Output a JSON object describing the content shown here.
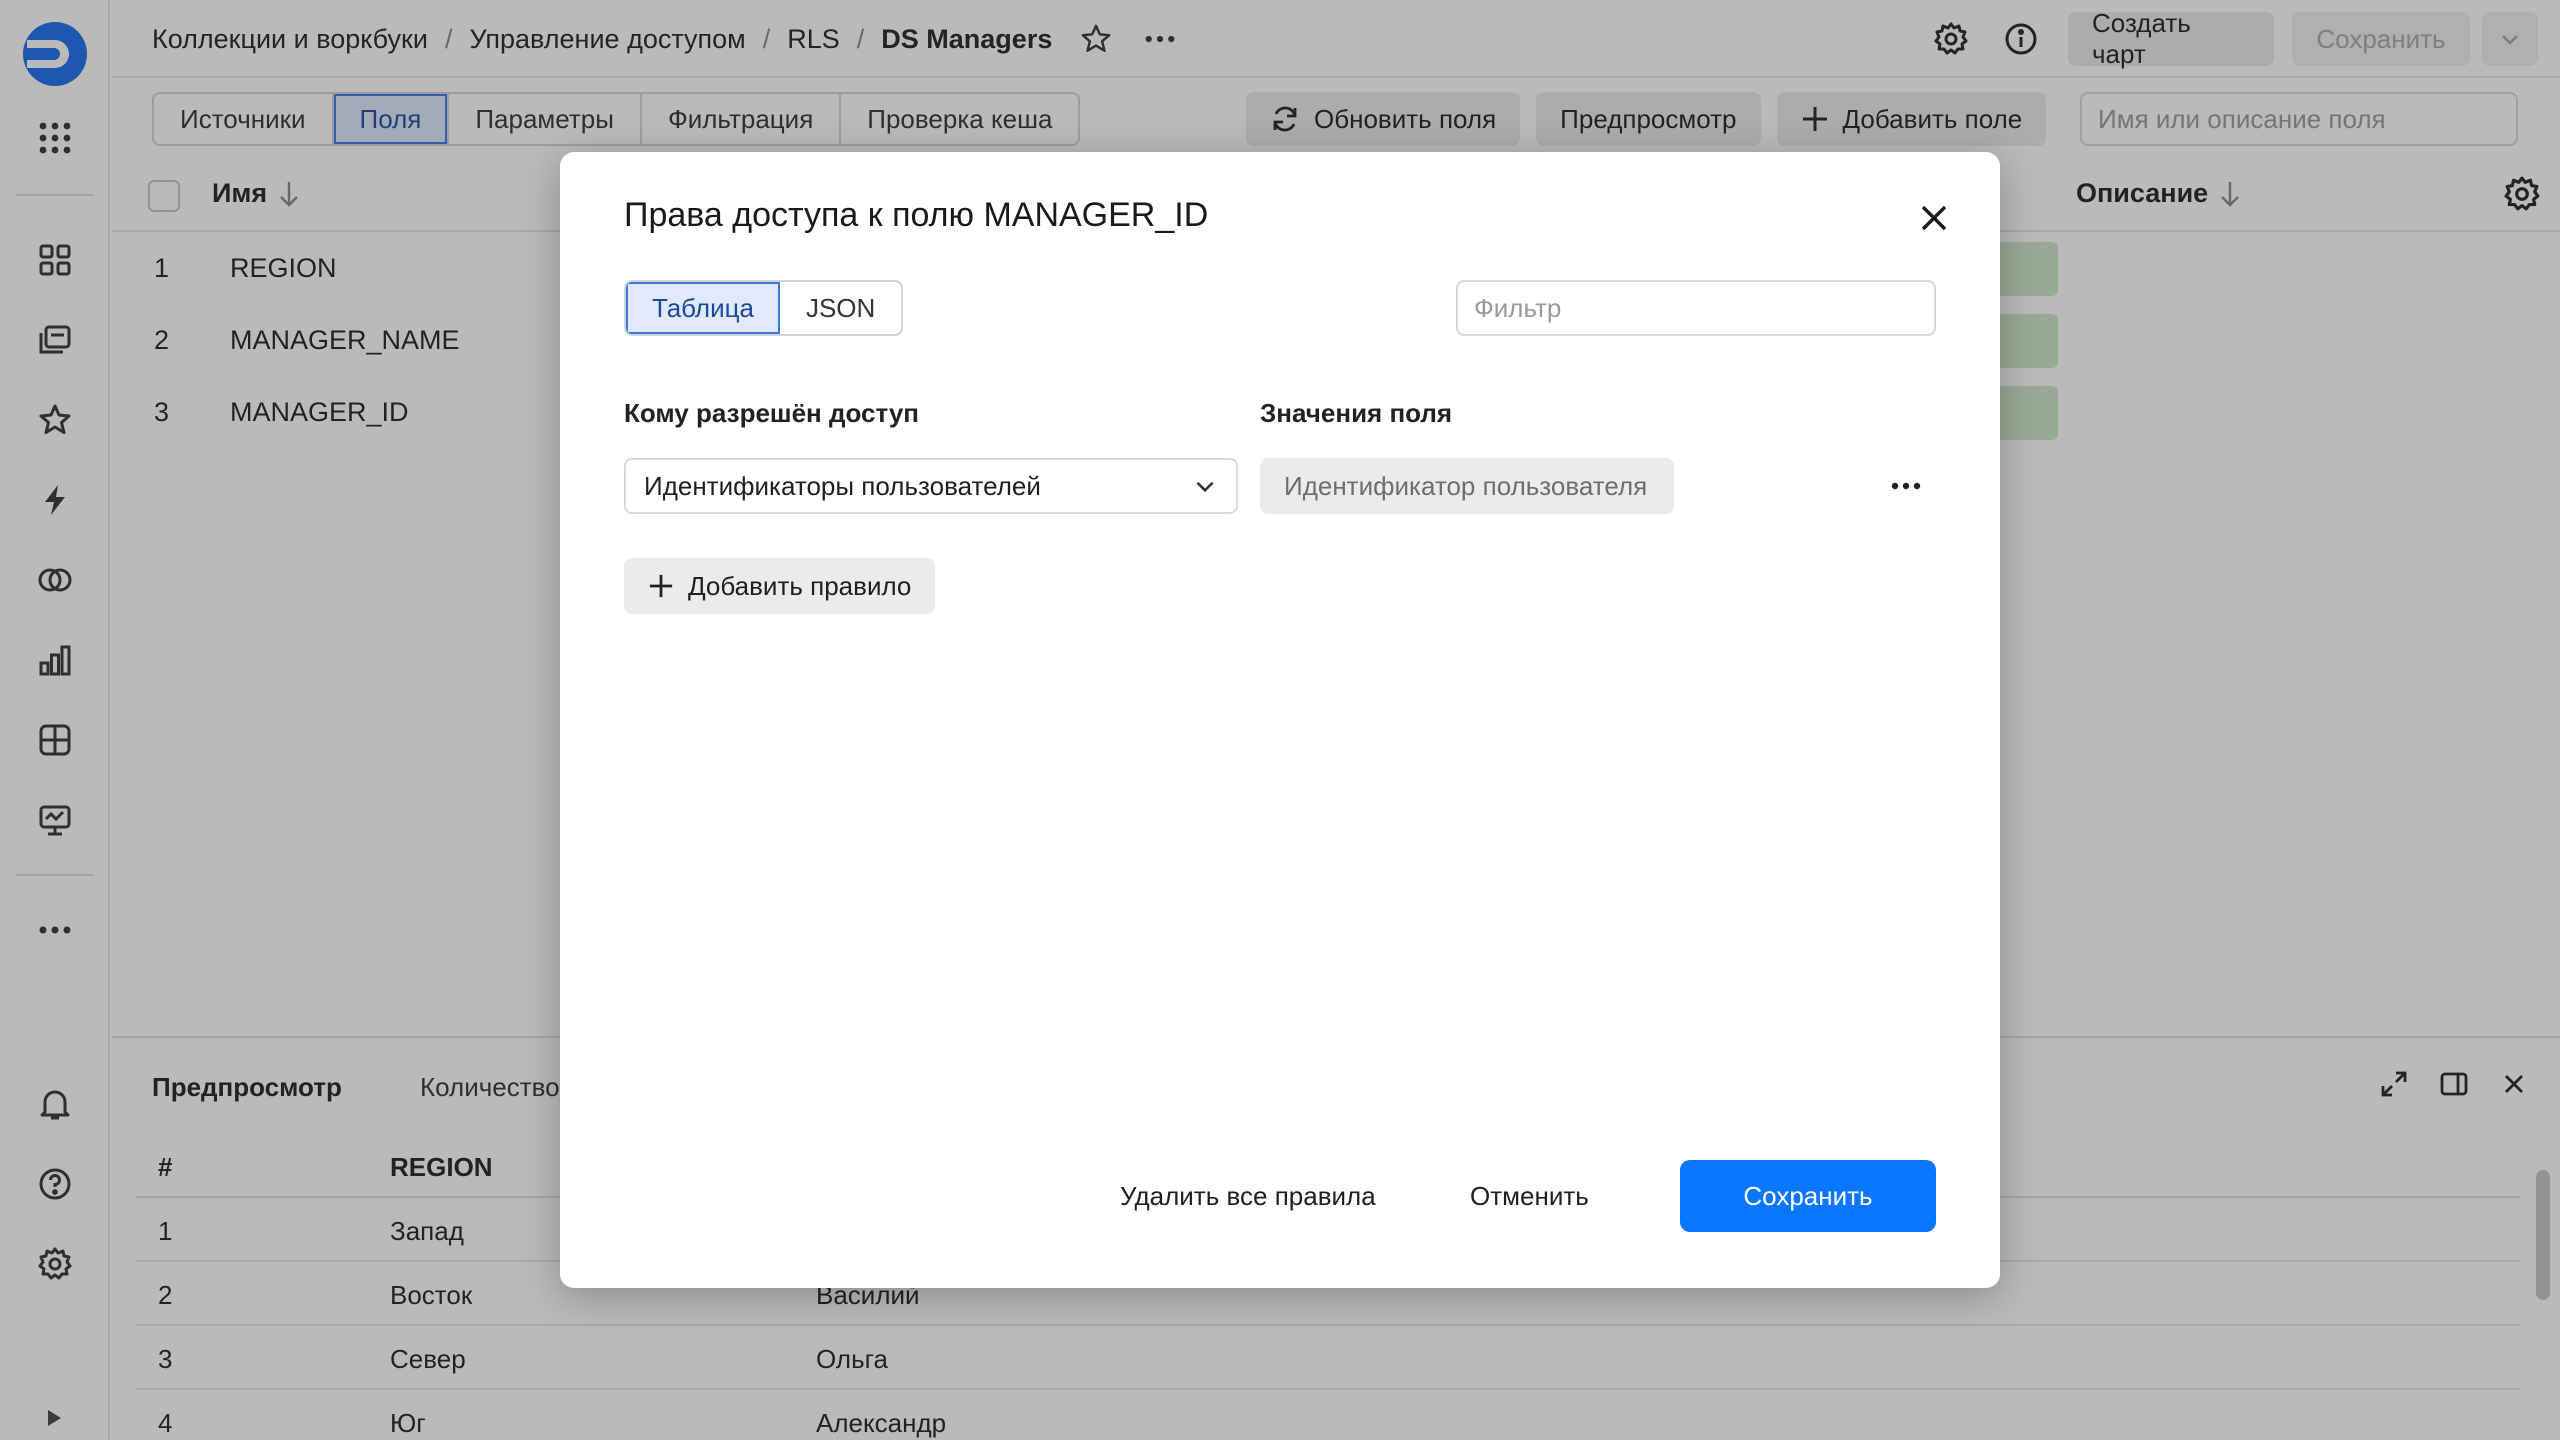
{
  "header": {
    "breadcrumbs": [
      "Коллекции и воркбуки",
      "Управление доступом",
      "RLS"
    ],
    "current": "DS Managers",
    "create_chart_label": "Создать чарт",
    "save_label": "Сохранить"
  },
  "toolbar": {
    "tabs": [
      "Источники",
      "Поля",
      "Параметры",
      "Фильтрация",
      "Проверка кеша"
    ],
    "active_tab": "Поля",
    "refresh_label": "Обновить поля",
    "preview_label": "Предпросмотр",
    "add_field_label": "Добавить поле",
    "search_placeholder": "Имя или описание поля"
  },
  "fields_table": {
    "col_name": "Имя",
    "col_description": "Описание",
    "rows": [
      {
        "num": "1",
        "name": "REGION"
      },
      {
        "num": "2",
        "name": "MANAGER_NAME"
      },
      {
        "num": "3",
        "name": "MANAGER_ID"
      }
    ]
  },
  "preview": {
    "title": "Предпросмотр",
    "count_label": "Количество",
    "headers": [
      "#",
      "REGION",
      ""
    ],
    "rows": [
      [
        "1",
        "Запад",
        ""
      ],
      [
        "2",
        "Восток",
        "Василий"
      ],
      [
        "3",
        "Север",
        "Ольга"
      ],
      [
        "4",
        "Юг",
        "Александр"
      ]
    ]
  },
  "modal": {
    "title": "Права доступа к полю MANAGER_ID",
    "view_options": [
      "Таблица",
      "JSON"
    ],
    "active_view": "Таблица",
    "filter_placeholder": "Фильтр",
    "access_label": "Кому разрешён доступ",
    "values_label": "Значения поля",
    "access_select_value": "Идентификаторы пользователей",
    "field_value": "Идентификатор пользователя",
    "add_rule_label": "Добавить правило",
    "delete_all_label": "Удалить все правила",
    "cancel_label": "Отменить",
    "save_label": "Сохранить"
  },
  "colors": {
    "primary": "#0b77ff",
    "active_tab_bg": "#dfe9fb",
    "overlay": "rgba(40,40,40,0.32)",
    "logo": "#1a6cf0"
  },
  "icons": [
    "app-logo-icon",
    "apps-grid-icon",
    "collections-icon",
    "workbooks-icon",
    "favorites-icon",
    "connections-icon",
    "datasets-icon",
    "charts-icon",
    "dashboards-icon",
    "reports-icon",
    "more-icon",
    "bell-icon",
    "help-icon",
    "settings-icon",
    "star-icon",
    "gear-icon",
    "info-icon",
    "chevron-down-icon",
    "refresh-icon",
    "plus-icon",
    "sort-arrow-icon",
    "close-icon",
    "expand-icon",
    "split-view-icon",
    "ellipsis-icon"
  ]
}
